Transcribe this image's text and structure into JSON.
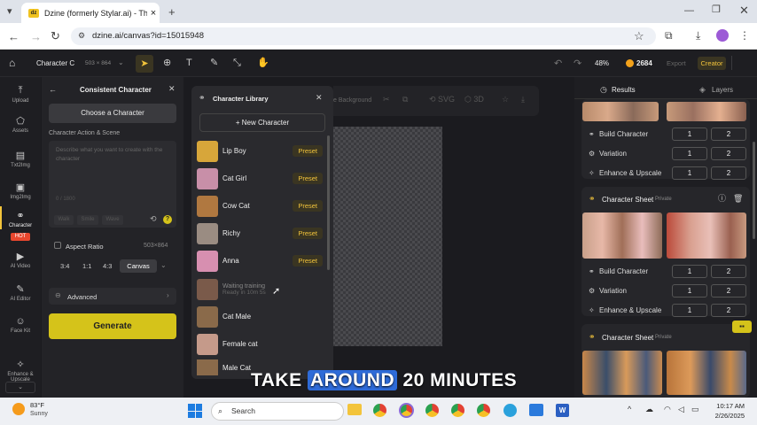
{
  "browser": {
    "tab_title": "Dzine (formerly Stylar.ai) - The",
    "tab_favicon": "dz",
    "url": "dzine.ai/canvas?id=15015948"
  },
  "topbar": {
    "project_name": "Character C",
    "size": "503 × 864",
    "zoom": "48%",
    "credits": "2684",
    "export_label": "Export",
    "creator_label": "Creator"
  },
  "leftnav": {
    "items": [
      {
        "label": "Upload",
        "icon": "upload-icon"
      },
      {
        "label": "Assets",
        "icon": "assets-icon"
      },
      {
        "label": "Txt2Img",
        "icon": "txt2img-icon"
      },
      {
        "label": "Img2Img",
        "icon": "img2img-icon"
      },
      {
        "label": "Character",
        "icon": "character-icon",
        "badge": "HOT"
      },
      {
        "label": "AI Video",
        "icon": "video-icon"
      },
      {
        "label": "AI Editor",
        "icon": "editor-icon"
      },
      {
        "label": "Face Kit",
        "icon": "face-icon"
      },
      {
        "label": "Enhance & Upscale",
        "icon": "enhance-icon"
      }
    ]
  },
  "panel": {
    "title": "Consistent Character",
    "choose_button": "Choose a Character",
    "action_label": "Character Action & Scene",
    "placeholder": "Describe what you want to create with the character",
    "counter": "0 / 1800",
    "chips": [
      "Walk",
      "Smile",
      "Wave"
    ],
    "aspect_label": "Aspect Ratio",
    "aspect_value": "503×864",
    "ratios": [
      "3:4",
      "1:1",
      "4:3",
      "Canvas"
    ],
    "advanced_label": "Advanced",
    "generate_label": "Generate"
  },
  "library": {
    "title": "Character Library",
    "new_button": "New Character",
    "characters": [
      {
        "name": "Lip Boy",
        "tag": "Preset",
        "color": "#d7a63a"
      },
      {
        "name": "Cat Girl",
        "tag": "Preset",
        "color": "#c88fa8"
      },
      {
        "name": "Cow Cat",
        "tag": "Preset",
        "color": "#b07840"
      },
      {
        "name": "Richy",
        "tag": "Preset",
        "color": "#9a8c82"
      },
      {
        "name": "Anna",
        "tag": "Preset",
        "color": "#d78fb0"
      },
      {
        "name": "Waiting training",
        "sub": "Ready in 10m 5s",
        "tag": "",
        "color": "#7a5a4a"
      },
      {
        "name": "Cat Male",
        "tag": "",
        "color": "#8a6a4a"
      },
      {
        "name": "Female cat",
        "tag": "",
        "color": "#c59a8a"
      },
      {
        "name": "Male Cat",
        "tag": "",
        "color": "#8a6a4a"
      }
    ]
  },
  "canvas_toolbar": {
    "bg_label": "e Background"
  },
  "right": {
    "tab_results": "Results",
    "tab_layers": "Layers",
    "rows": [
      {
        "label": "Build Character",
        "a": "1",
        "b": "2"
      },
      {
        "label": "Variation",
        "a": "1",
        "b": "2"
      },
      {
        "label": "Enhance & Upscale",
        "a": "1",
        "b": "2"
      }
    ],
    "sheet_title": "Character Sheet",
    "private": "Private"
  },
  "caption": {
    "pre": "TAKE",
    "highlight": "AROUND",
    "post": "20 MINUTES"
  },
  "taskbar": {
    "weather_temp": "83°F",
    "weather_text": "Sunny",
    "search": "Search",
    "time": "10:17 AM",
    "date": "2/26/2025"
  }
}
